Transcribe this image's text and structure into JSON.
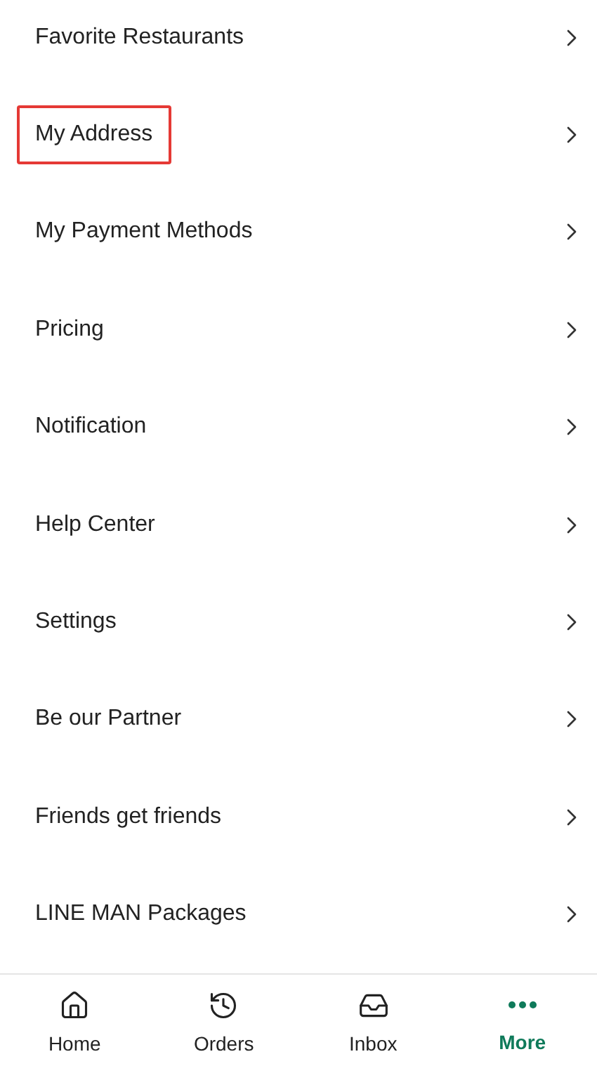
{
  "menu_items": [
    {
      "label": "Favorite Restaurants",
      "highlighted": false
    },
    {
      "label": "My Address",
      "highlighted": true
    },
    {
      "label": "My Payment Methods",
      "highlighted": false
    },
    {
      "label": "Pricing",
      "highlighted": false
    },
    {
      "label": "Notification",
      "highlighted": false
    },
    {
      "label": "Help Center",
      "highlighted": false
    },
    {
      "label": "Settings",
      "highlighted": false
    },
    {
      "label": "Be our Partner",
      "highlighted": false
    },
    {
      "label": "Friends get friends",
      "highlighted": false
    },
    {
      "label": "LINE MAN Packages",
      "highlighted": false
    }
  ],
  "bottom_nav": [
    {
      "label": "Home",
      "kind": "home",
      "selected": false
    },
    {
      "label": "Orders",
      "kind": "orders",
      "selected": false
    },
    {
      "label": "Inbox",
      "kind": "inbox",
      "selected": false
    },
    {
      "label": "More",
      "kind": "more",
      "selected": true
    }
  ]
}
